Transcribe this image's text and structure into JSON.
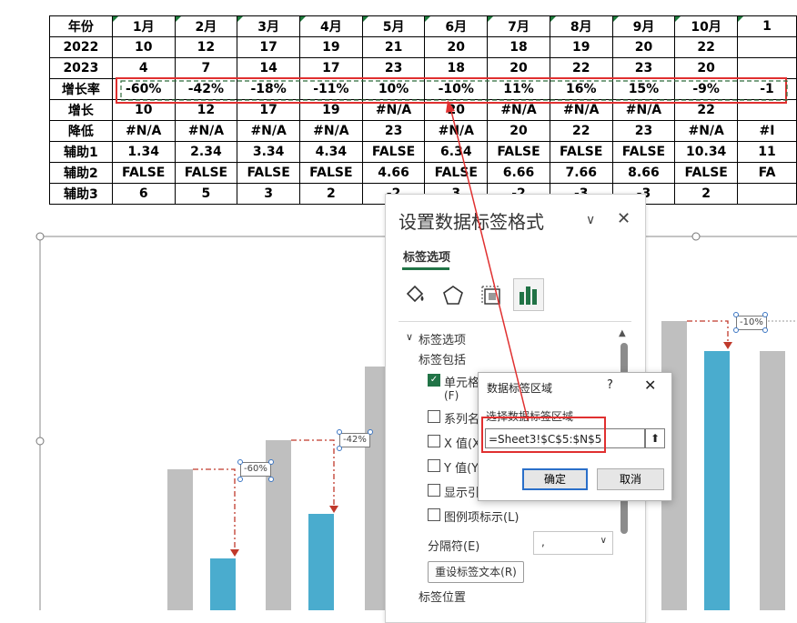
{
  "sheet": {
    "header": [
      "年份",
      "1月",
      "2月",
      "3月",
      "4月",
      "5月",
      "6月",
      "7月",
      "8月",
      "9月",
      "10月",
      "1"
    ],
    "rows": [
      [
        "2022",
        "10",
        "12",
        "17",
        "19",
        "21",
        "20",
        "18",
        "19",
        "20",
        "22",
        ""
      ],
      [
        "2023",
        "4",
        "7",
        "14",
        "17",
        "23",
        "18",
        "20",
        "22",
        "23",
        "20",
        ""
      ],
      [
        "增长率",
        "-60%",
        "-42%",
        "-18%",
        "-11%",
        "10%",
        "-10%",
        "11%",
        "16%",
        "15%",
        "-9%",
        "-1"
      ],
      [
        "增长",
        "10",
        "12",
        "17",
        "19",
        "#N/A",
        "20",
        "#N/A",
        "#N/A",
        "#N/A",
        "22",
        ""
      ],
      [
        "降低",
        "#N/A",
        "#N/A",
        "#N/A",
        "#N/A",
        "23",
        "#N/A",
        "20",
        "22",
        "23",
        "#N/A",
        "#I"
      ],
      [
        "辅助1",
        "1.34",
        "2.34",
        "3.34",
        "4.34",
        "FALSE",
        "6.34",
        "FALSE",
        "FALSE",
        "FALSE",
        "10.34",
        "11"
      ],
      [
        "辅助2",
        "FALSE",
        "FALSE",
        "FALSE",
        "FALSE",
        "4.66",
        "FALSE",
        "6.66",
        "7.66",
        "8.66",
        "FALSE",
        "FA"
      ],
      [
        "辅助3",
        "6",
        "5",
        "3",
        "2",
        "-2",
        "3",
        "-2",
        "-3",
        "-3",
        "2",
        ""
      ]
    ]
  },
  "chart": {
    "data_labels": [
      "-60%",
      "-42%",
      "-10%"
    ]
  },
  "pane": {
    "title": "设置数据标签格式",
    "tab": "标签选项",
    "section": "标签选项",
    "includes": "标签包括",
    "checkboxes": [
      {
        "label": "单元格",
        "checked": true
      },
      {
        "label": "系列名",
        "checked": false
      },
      {
        "label": "X 值(X)",
        "checked": false
      },
      {
        "label": "Y 值(Y)",
        "checked": false
      },
      {
        "label": "显示引",
        "checked": false
      },
      {
        "label": "图例项标示(L)",
        "checked": false
      }
    ],
    "cell_key": "(F)",
    "separator_label": "分隔符(E)",
    "separator_value": ",",
    "reset_button": "重设标签文本(R)",
    "position_label": "标签位置"
  },
  "dialog": {
    "title": "数据标签区域",
    "help": "?",
    "prompt": "选择数据标签区域",
    "range_value": "=Sheet3!$C$5:$N$5",
    "ok": "确定",
    "cancel": "取消"
  },
  "colors": {
    "gray_bar": "#bfbfbf",
    "blue_bar": "#4aacce",
    "arrow_red": "#c0392b",
    "highlight_red": "#e03030",
    "excel_green": "#217346"
  }
}
